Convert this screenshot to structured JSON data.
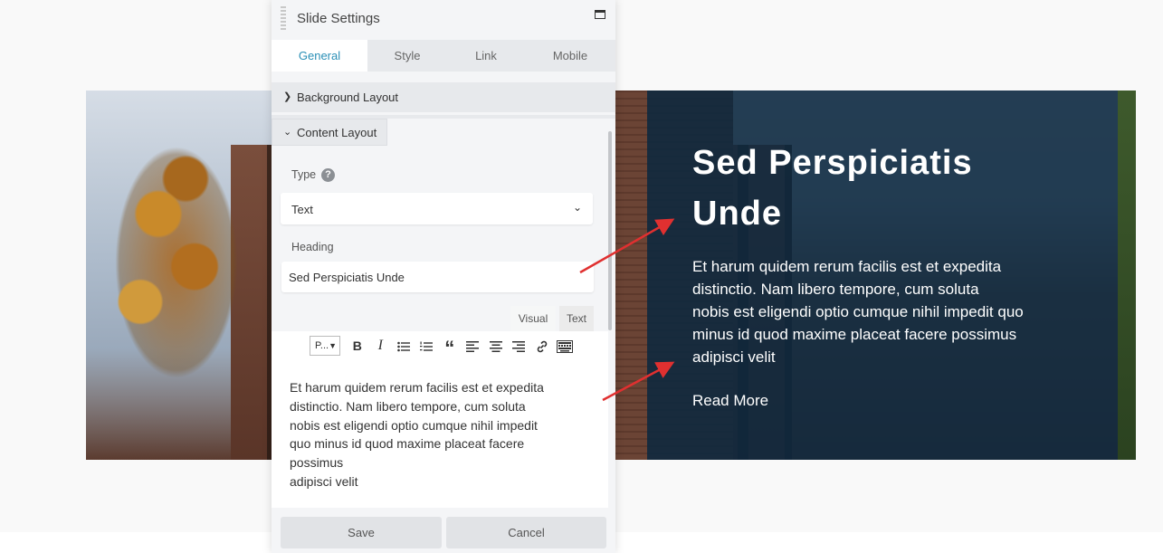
{
  "hero": {
    "title_line1": "Sed Perspiciatis",
    "title_line2": "Unde",
    "text_lines": [
      "Et harum quidem rerum facilis est et expedita",
      "distinctio. Nam libero tempore, cum soluta",
      "nobis est eligendi optio cumque nihil impedit quo",
      "minus id quod maxime placeat facere possimus",
      "adipisci velit"
    ],
    "link": "Read More",
    "overlay_color": "#0d283f"
  },
  "panel": {
    "title": "Slide Settings",
    "tabs": [
      {
        "label": "General",
        "active": true
      },
      {
        "label": "Style",
        "active": false
      },
      {
        "label": "Link",
        "active": false
      },
      {
        "label": "Mobile",
        "active": false
      }
    ],
    "sections": {
      "background_layout": "Background Layout",
      "content_layout": "Content Layout"
    },
    "type_label": "Type",
    "type_value": "Text",
    "heading_label": "Heading",
    "heading_value": "Sed Perspiciatis Unde",
    "editor": {
      "tab_visual": "Visual",
      "tab_text": "Text",
      "format_select": "P...",
      "toolbar_icons": [
        "bold-icon",
        "italic-icon",
        "bulleted-list-icon",
        "numbered-list-icon",
        "blockquote-icon",
        "align-left-icon",
        "align-center-icon",
        "align-right-icon",
        "link-icon",
        "keyboard-icon"
      ],
      "content_lines": [
        "Et harum quidem rerum facilis est et expedita",
        "distinctio. Nam libero tempore, cum soluta",
        "nobis est eligendi optio cumque nihil impedit",
        "quo minus id quod maxime placeat facere",
        "possimus",
        "adipisci velit"
      ]
    },
    "save_label": "Save",
    "cancel_label": "Cancel",
    "accent_color": "#2a8fb6"
  },
  "annotation_arrow_color": "#e03030"
}
